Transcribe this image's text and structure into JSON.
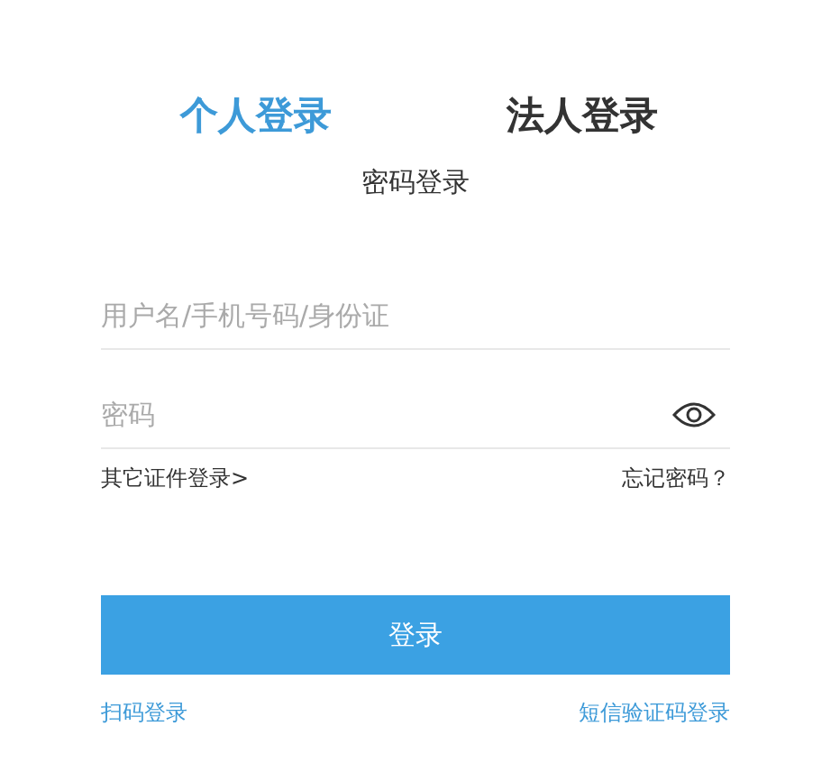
{
  "tabs": [
    {
      "label": "个人登录",
      "selected": true
    },
    {
      "label": "法人登录",
      "selected": false
    }
  ],
  "subtitle": "密码登录",
  "username": {
    "placeholder": "用户名/手机号码/身份证"
  },
  "password": {
    "placeholder": "密码"
  },
  "other_id_link": "其它证件登录>",
  "forgot_link": "忘记密码？",
  "login_button": "登录",
  "qr_link": "扫码登录",
  "sms_link": "短信验证码登录"
}
